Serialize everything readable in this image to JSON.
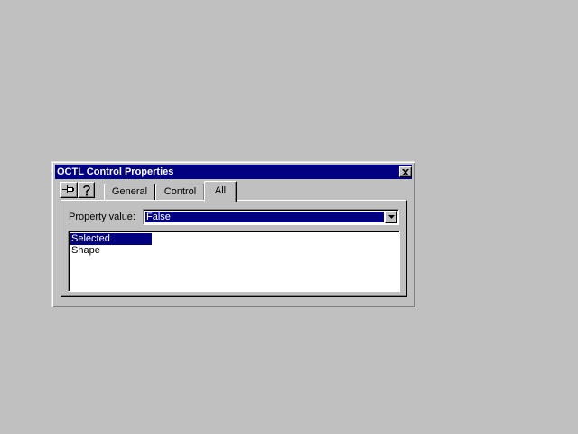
{
  "window": {
    "title": "OCTL Control Properties"
  },
  "toolbar": {
    "pin_icon": "pushpin-icon",
    "help_icon": "help-icon"
  },
  "tabs": [
    {
      "label": "General"
    },
    {
      "label": "Control"
    },
    {
      "label": "All",
      "active": true
    }
  ],
  "property": {
    "label": "Property value:",
    "value": "False"
  },
  "list": {
    "items": [
      {
        "label": "Selected",
        "selected": true
      },
      {
        "label": "Shape",
        "selected": false
      }
    ]
  },
  "colors": {
    "desktop": "#c0c0c0",
    "titlebar": "#000080",
    "selection": "#000080"
  }
}
